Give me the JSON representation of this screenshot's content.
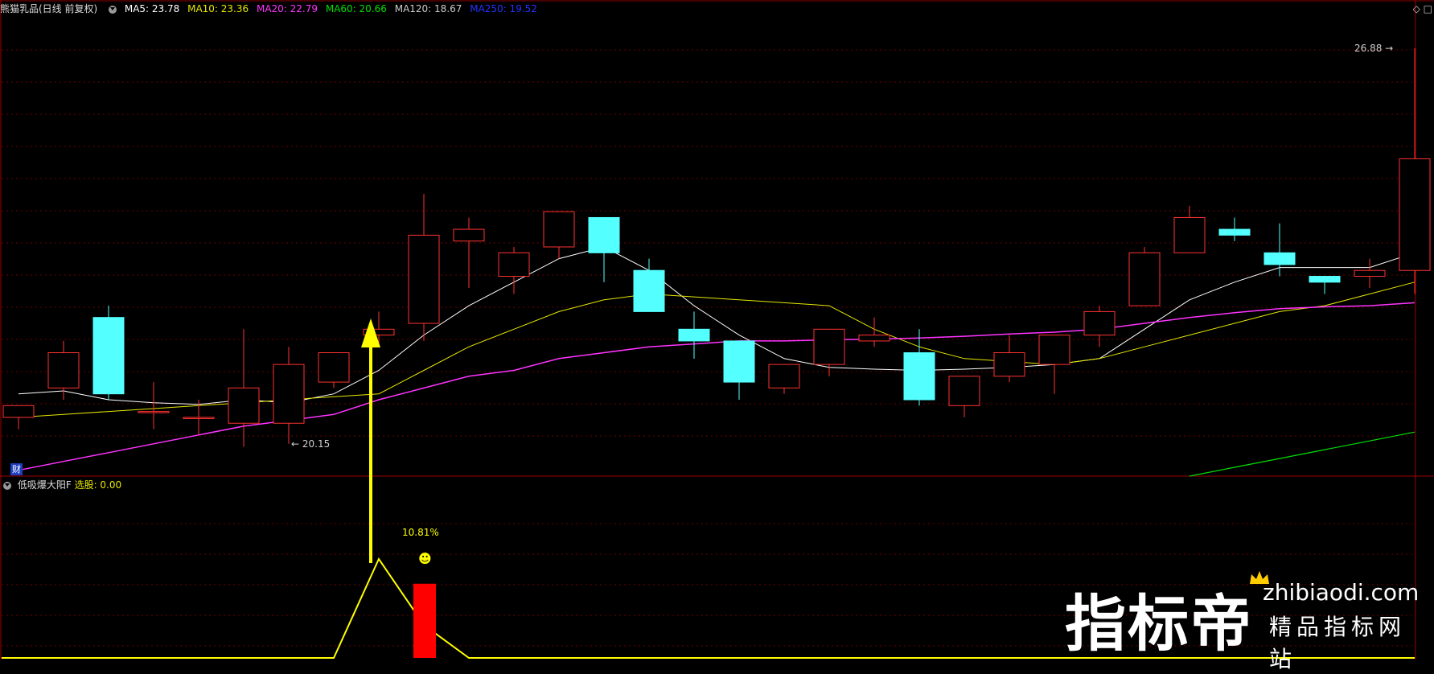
{
  "header": {
    "title": "熊猫乳品(日线 前复权)",
    "ma5": {
      "label": "MA5: 23.78",
      "color": "#ffffff"
    },
    "ma10": {
      "label": "MA10: 23.36",
      "color": "#e6e600"
    },
    "ma20": {
      "label": "MA20: 22.79",
      "color": "#ff33ff"
    },
    "ma60": {
      "label": "MA60: 20.66",
      "color": "#00e000"
    },
    "ma120": {
      "label": "MA120: 18.67",
      "color": "#cccccc"
    },
    "ma250": {
      "label": "MA250: 19.52",
      "color": "#2233ff"
    }
  },
  "cai_label": "财",
  "indicator_header": {
    "name": "低吸爆大阳F",
    "value_label": "选股: 0.00"
  },
  "top_right": {
    "icons": [
      "diamond-icon",
      "square-icon"
    ]
  },
  "watermark": {
    "brand": "指标帝",
    "url": "zhibiaodi.com",
    "subtitle": "精品指标网站"
  },
  "chart_data": {
    "type": "candlestick",
    "price_range": [
      19.6,
      27.4
    ],
    "annotations": {
      "high_label": "26.88",
      "low_label": "20.15",
      "signal_label": "10.81%",
      "smiley": "☻"
    },
    "candles": [
      {
        "o": 20.6,
        "h": 20.8,
        "l": 20.4,
        "c": 20.8
      },
      {
        "o": 21.1,
        "h": 21.9,
        "l": 20.9,
        "c": 21.7
      },
      {
        "o": 22.3,
        "h": 22.5,
        "l": 20.9,
        "c": 21.0
      },
      {
        "o": 20.7,
        "h": 21.2,
        "l": 20.4,
        "c": 20.7
      },
      {
        "o": 20.6,
        "h": 20.9,
        "l": 20.3,
        "c": 20.6
      },
      {
        "o": 20.5,
        "h": 22.1,
        "l": 20.1,
        "c": 21.1
      },
      {
        "o": 20.5,
        "h": 21.8,
        "l": 20.15,
        "c": 21.5
      },
      {
        "o": 21.2,
        "h": 21.7,
        "l": 21.1,
        "c": 21.7
      },
      {
        "o": 22.0,
        "h": 22.4,
        "l": 21.8,
        "c": 22.1
      },
      {
        "o": 22.2,
        "h": 24.4,
        "l": 21.9,
        "c": 23.7
      },
      {
        "o": 23.6,
        "h": 24.0,
        "l": 22.8,
        "c": 23.8
      },
      {
        "o": 23.0,
        "h": 23.5,
        "l": 22.7,
        "c": 23.4
      },
      {
        "o": 23.5,
        "h": 24.1,
        "l": 23.3,
        "c": 24.1
      },
      {
        "o": 24.0,
        "h": 24.0,
        "l": 22.9,
        "c": 23.4
      },
      {
        "o": 23.1,
        "h": 23.3,
        "l": 22.4,
        "c": 22.4
      },
      {
        "o": 22.1,
        "h": 22.4,
        "l": 21.6,
        "c": 21.9
      },
      {
        "o": 21.9,
        "h": 21.9,
        "l": 20.9,
        "c": 21.2
      },
      {
        "o": 21.1,
        "h": 21.5,
        "l": 21.0,
        "c": 21.5
      },
      {
        "o": 21.5,
        "h": 22.1,
        "l": 21.3,
        "c": 22.1
      },
      {
        "o": 21.9,
        "h": 22.3,
        "l": 21.8,
        "c": 22.0
      },
      {
        "o": 21.7,
        "h": 22.1,
        "l": 20.8,
        "c": 20.9
      },
      {
        "o": 20.8,
        "h": 21.3,
        "l": 20.6,
        "c": 21.3
      },
      {
        "o": 21.3,
        "h": 22.0,
        "l": 21.2,
        "c": 21.7
      },
      {
        "o": 21.5,
        "h": 22.0,
        "l": 21.0,
        "c": 22.0
      },
      {
        "o": 22.0,
        "h": 22.5,
        "l": 21.8,
        "c": 22.4
      },
      {
        "o": 22.5,
        "h": 23.5,
        "l": 22.5,
        "c": 23.4
      },
      {
        "o": 23.4,
        "h": 24.2,
        "l": 23.4,
        "c": 24.0
      },
      {
        "o": 23.8,
        "h": 24.0,
        "l": 23.6,
        "c": 23.7
      },
      {
        "o": 23.4,
        "h": 23.9,
        "l": 23.0,
        "c": 23.2
      },
      {
        "o": 23.0,
        "h": 23.0,
        "l": 22.7,
        "c": 22.9
      },
      {
        "o": 23.0,
        "h": 23.3,
        "l": 22.8,
        "c": 23.1
      },
      {
        "o": 23.1,
        "h": 26.88,
        "l": 22.7,
        "c": 25.0
      }
    ],
    "ma_lines": {
      "ma5": [
        21.0,
        21.05,
        20.9,
        20.85,
        20.82,
        20.9,
        20.85,
        21.0,
        21.4,
        22.0,
        22.5,
        22.9,
        23.3,
        23.5,
        23.1,
        22.5,
        22.0,
        21.6,
        21.45,
        21.42,
        21.4,
        21.42,
        21.45,
        21.5,
        21.6,
        22.1,
        22.6,
        22.9,
        23.15,
        23.15,
        23.15,
        23.4
      ],
      "ma10": [
        20.6,
        20.65,
        20.7,
        20.75,
        20.8,
        20.85,
        20.9,
        20.95,
        21.0,
        21.4,
        21.8,
        22.1,
        22.4,
        22.6,
        22.7,
        22.65,
        22.6,
        22.55,
        22.5,
        22.1,
        21.8,
        21.6,
        21.55,
        21.5,
        21.6,
        21.8,
        22.0,
        22.2,
        22.4,
        22.5,
        22.7,
        22.9
      ],
      "ma20": [
        19.7,
        19.85,
        20.0,
        20.15,
        20.3,
        20.45,
        20.55,
        20.65,
        20.9,
        21.1,
        21.3,
        21.4,
        21.6,
        21.7,
        21.8,
        21.85,
        21.9,
        21.9,
        21.92,
        21.93,
        21.95,
        21.98,
        22.02,
        22.05,
        22.1,
        22.2,
        22.3,
        22.38,
        22.45,
        22.48,
        22.5,
        22.55
      ],
      "ma60": [
        null,
        null,
        null,
        null,
        null,
        null,
        null,
        null,
        null,
        null,
        null,
        null,
        null,
        null,
        null,
        null,
        null,
        null,
        null,
        null,
        null,
        null,
        null,
        null,
        null,
        null,
        19.6,
        19.75,
        19.9,
        20.05,
        20.2,
        20.35
      ]
    },
    "indicator": {
      "name": "低吸爆大阳F",
      "line_values": [
        0,
        0,
        0,
        0,
        0,
        0,
        0,
        0,
        0.6,
        0.2,
        0,
        0,
        0,
        0,
        0,
        0,
        0,
        0,
        0,
        0,
        0,
        0,
        0,
        0,
        0,
        0,
        0,
        0,
        0,
        0,
        0,
        0
      ],
      "bar_index": 9,
      "bar_value": 0.45
    }
  }
}
